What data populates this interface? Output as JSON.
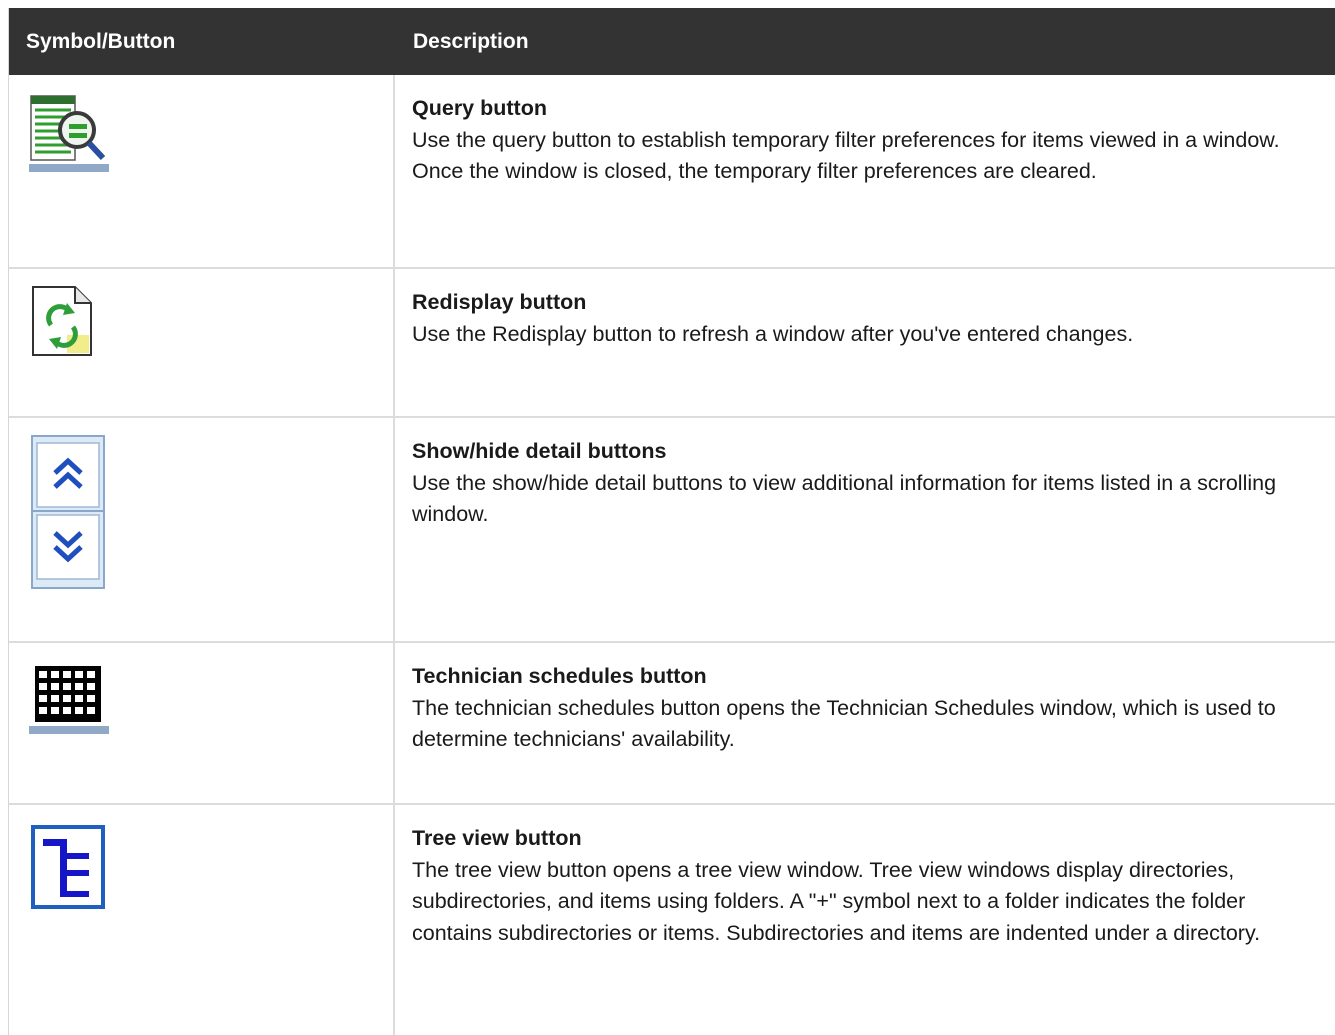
{
  "table": {
    "header": {
      "symbol": "Symbol/Button",
      "description": "Description"
    },
    "rows": [
      {
        "icon": "query-icon",
        "title": "Query button",
        "description": "Use the query button to establish temporary filter preferences for items viewed in a window. Once the window is closed, the temporary filter preferences are cleared."
      },
      {
        "icon": "redisplay-icon",
        "title": "Redisplay button",
        "description": "Use the Redisplay button to refresh a window after you've entered changes."
      },
      {
        "icon": "show-hide-detail-icon",
        "title": "Show/hide detail buttons",
        "description": "Use the show/hide detail buttons to view additional information for items listed in a scrolling window."
      },
      {
        "icon": "technician-schedules-icon",
        "title": "Technician schedules button",
        "description": "The technician schedules button opens the Technician Schedules window, which is used to determine technicians' availability."
      },
      {
        "icon": "tree-view-icon",
        "title": "Tree view button",
        "description": "The tree view button opens a tree view window. Tree view windows display directories, subdirectories, and items using folders. A \"+\" symbol next to a folder indicates the folder contains subdirectories or items. Subdirectories and items are indented under a directory."
      }
    ]
  },
  "colors": {
    "header_bg": "#333333",
    "header_text": "#ffffff",
    "grid": "#dcdcdc"
  }
}
